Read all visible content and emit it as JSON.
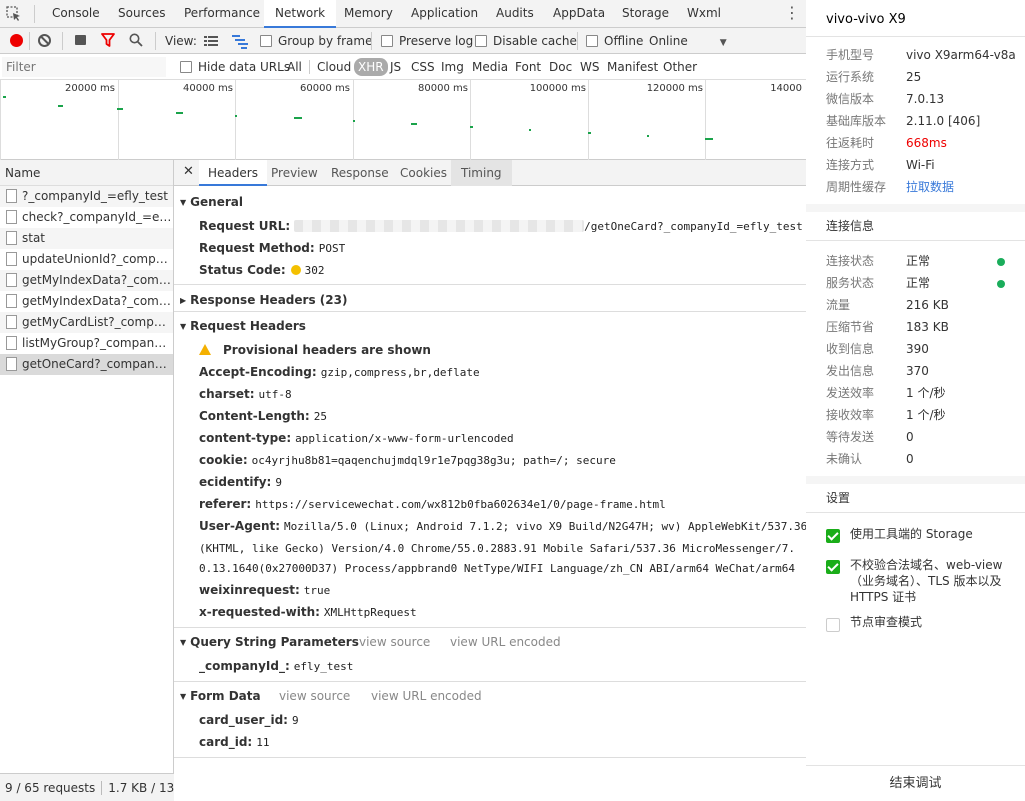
{
  "tabs": [
    "Console",
    "Sources",
    "Performance",
    "Network",
    "Memory",
    "Application",
    "Audits",
    "AppData",
    "Storage",
    "Wxml"
  ],
  "active_tab": "Network",
  "toolbar": {
    "view_label": "View:",
    "group_by_frame": "Group by frame",
    "preserve_log": "Preserve log",
    "disable_cache": "Disable cache",
    "offline": "Offline",
    "throttle": "Online"
  },
  "filter": {
    "placeholder": "Filter",
    "hide_data_urls": "Hide data URLs",
    "types": [
      "All",
      "Cloud",
      "XHR",
      "JS",
      "CSS",
      "Img",
      "Media",
      "Font",
      "Doc",
      "WS",
      "Manifest",
      "Other"
    ],
    "active_type": "XHR"
  },
  "overview": {
    "labels": [
      "20000 ms",
      "40000 ms",
      "60000 ms",
      "80000 ms",
      "100000 ms",
      "120000 ms",
      "14000"
    ]
  },
  "requests": {
    "header": "Name",
    "items": [
      "?_companyId_=efly_test",
      "check?_companyId_=efly_...",
      "stat",
      "updateUnionId?_compan...",
      "getMyIndexData?_compa...",
      "getMyIndexData?_compa...",
      "getMyCardList?_company...",
      "listMyGroup?_companyId...",
      "getOneCard?_companyId..."
    ],
    "selected_index": 8
  },
  "status": {
    "requests": "9 / 65 requests",
    "size": "1.7 KB / 13..."
  },
  "detail_tabs": [
    "Headers",
    "Preview",
    "Response",
    "Cookies",
    "Timing"
  ],
  "general": {
    "title": "General",
    "request_url_key": "Request URL:",
    "request_url_value": "/getOneCard?_companyId_=efly_test",
    "request_method_key": "Request Method:",
    "request_method_value": "POST",
    "status_code_key": "Status Code:",
    "status_code_value": "302"
  },
  "response_headers": {
    "title": "Response Headers (23)"
  },
  "request_headers": {
    "title": "Request Headers",
    "warning": "Provisional headers are shown",
    "items": [
      {
        "k": "Accept-Encoding:",
        "v": "gzip,compress,br,deflate"
      },
      {
        "k": "charset:",
        "v": "utf-8"
      },
      {
        "k": "Content-Length:",
        "v": "25"
      },
      {
        "k": "content-type:",
        "v": "application/x-www-form-urlencoded"
      },
      {
        "k": "cookie:",
        "v": "oc4yrjhu8b81=qaqenchujmdql9r1e7pqg38g3u; path=/; secure"
      },
      {
        "k": "ecidentify:",
        "v": "9"
      },
      {
        "k": "referer:",
        "v": "https://servicewechat.com/wx812b0fba602634e1/0/page-frame.html"
      }
    ],
    "user_agent_key": "User-Agent:",
    "user_agent_lines": [
      "Mozilla/5.0 (Linux; Android 7.1.2; vivo X9 Build/N2G47H; wv) AppleWebKit/537.36",
      "(KHTML, like Gecko) Version/4.0 Chrome/55.0.2883.91 Mobile Safari/537.36 MicroMessenger/7.",
      "0.13.1640(0x27000D37) Process/appbrand0 NetType/WIFI Language/zh_CN ABI/arm64 WeChat/arm64"
    ],
    "items2": [
      {
        "k": "weixinrequest:",
        "v": "true"
      },
      {
        "k": "x-requested-with:",
        "v": "XMLHttpRequest"
      }
    ]
  },
  "query_params": {
    "title": "Query String Parameters",
    "view_source": "view source",
    "view_url_encoded": "view URL encoded",
    "items": [
      {
        "k": "_companyId_:",
        "v": "efly_test"
      }
    ]
  },
  "form_data": {
    "title": "Form Data",
    "view_source": "view source",
    "view_url_encoded": "view URL encoded",
    "items": [
      {
        "k": "card_user_id:",
        "v": "9"
      },
      {
        "k": "card_id:",
        "v": "11"
      }
    ]
  },
  "panel": {
    "title": "vivo-vivo X9",
    "device": [
      {
        "k": "手机型号",
        "v": "vivo X9arm64-v8a"
      },
      {
        "k": "运行系统",
        "v": "25"
      },
      {
        "k": "微信版本",
        "v": "7.0.13"
      },
      {
        "k": "基础库版本",
        "v": "2.11.0 [406]"
      },
      {
        "k": "往返耗时",
        "v": "668ms"
      },
      {
        "k": "连接方式",
        "v": "Wi-Fi"
      },
      {
        "k": "周期性缓存",
        "v": "拉取数据"
      }
    ],
    "conn_title": "连接信息",
    "conn": [
      {
        "k": "连接状态",
        "v": "正常"
      },
      {
        "k": "服务状态",
        "v": "正常"
      },
      {
        "k": "流量",
        "v": "216 KB"
      },
      {
        "k": "压缩节省",
        "v": "183 KB"
      },
      {
        "k": "收到信息",
        "v": "390"
      },
      {
        "k": "发出信息",
        "v": "370"
      },
      {
        "k": "发送效率",
        "v": "1 个/秒"
      },
      {
        "k": "接收效率",
        "v": "1 个/秒"
      },
      {
        "k": "等待发送",
        "v": "0"
      },
      {
        "k": "未确认",
        "v": "0"
      }
    ],
    "settings_title": "设置",
    "settings": [
      {
        "label": "使用工具端的 Storage",
        "checked": true
      },
      {
        "label": "不校验合法域名、web-view（业务域名）、TLS 版本以及 HTTPS 证书",
        "checked": true
      },
      {
        "label": "节点审查模式",
        "checked": false
      }
    ],
    "end_button": "结束调试"
  },
  "colors": {
    "accent": "#3879d9",
    "record": "#ee0000",
    "ok": "#1aad5b",
    "check": "#1aad19"
  }
}
